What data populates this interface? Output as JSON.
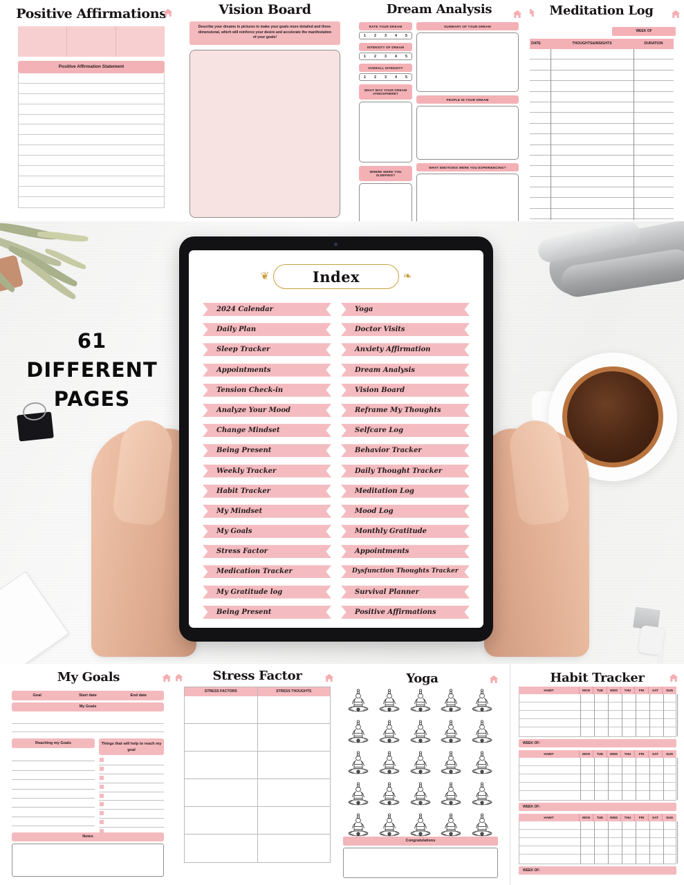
{
  "promo": {
    "headline_line1": "61 DIFFERENT",
    "headline_line2": "PAGES"
  },
  "tablet": {
    "index": {
      "title": "Index",
      "left_column": [
        "2024 Calendar",
        "Daily Plan",
        "Sleep Tracker",
        "Appointments",
        "Tension Check-in",
        "Analyze Your Mood",
        "Change Mindset",
        "Being Present",
        "Weekly Tracker",
        "Habit Tracker",
        "My Mindset",
        "My Goals",
        "Stress Factor",
        "Medication Tracker",
        "My Gratitude log",
        "Being Present"
      ],
      "right_column": [
        "Yoga",
        "Doctor Visits",
        "Anxiety Affirmation",
        "Dream Analysis",
        "Vision Board",
        "Reframe My Thoughts",
        "Selfcare Log",
        "Behavior Tracker",
        "Daily Thought Tracker",
        "Meditation Log",
        "Mood Log",
        "Monthly Gratitude",
        "Appointments",
        "Dysfunction Thoughts Tracker",
        "Survival Planner",
        "Positive Affirmations"
      ]
    }
  },
  "pages": {
    "positive_affirmations": {
      "title": "Positive Affirmations",
      "statement_header": "Positive Affirmation Statement",
      "line_count": 13
    },
    "vision_board": {
      "title": "Vision Board",
      "description": "Describe your dreams in pictures to make your goals more detailed and three-dimensional, which will reinforce your desire and accelerate the manifestation of your goals!"
    },
    "dream_analysis": {
      "title": "Dream Analysis",
      "scales": [
        {
          "label": "RATE YOUR DREAM",
          "values": [
            "1",
            "2",
            "3",
            "4",
            "5"
          ]
        },
        {
          "label": "INTENSITY OF DREAM",
          "values": [
            "1",
            "2",
            "3",
            "4",
            "5"
          ]
        },
        {
          "label": "OVERALL INTENSITY",
          "values": [
            "1",
            "2",
            "3",
            "4",
            "5"
          ]
        }
      ],
      "atmosphere_label": "WHAT WAS YOUR DREAM ATMOSPHERE?",
      "sleeping_label": "WHERE WERE YOU SLEEPING?",
      "summary_label": "SUMMARY OF YOUR DREAM",
      "people_label": "PEOPLE IN YOUR DREAM",
      "emotions_label": "WHAT EMOTIONS WERE YOU EXPERIENCING?"
    },
    "meditation_log": {
      "title": "Meditation Log",
      "week_of": "WEEK OF",
      "columns": [
        "DATE",
        "THOUGHTS&INSIGHTS",
        "DURATION"
      ],
      "row_count": 16
    },
    "my_goals": {
      "title": "My Goals",
      "top_columns": [
        "Goal",
        "Start date",
        "End date"
      ],
      "my_goals_band": "My Goals",
      "reaching_label": "Reaching my Goals",
      "helping_label": "Things that will help to reach my goal",
      "notes_label": "Notes"
    },
    "stress_factor": {
      "title": "Stress Factor",
      "columns": [
        "STRESS FACTORS",
        "STRESS THOUGHTS"
      ],
      "row_count": 6
    },
    "yoga": {
      "title": "Yoga",
      "figure_rows": 5,
      "figure_cols": 5,
      "congrats_label": "Congratulations"
    },
    "habit_tracker": {
      "title": "Habit Tracker",
      "columns": [
        "HABIT",
        "MON",
        "TUE",
        "WED",
        "THU",
        "FRI",
        "SAT",
        "SUN"
      ],
      "week_of_label": "WEEK OF:",
      "block_count": 3
    }
  },
  "icons": {
    "home": "home-icon"
  },
  "colors": {
    "pink_band": "#f4b9bd",
    "pink_soft": "#f8e3e3",
    "gold_frame": "#c8a13f",
    "ink": "#1a1516"
  }
}
